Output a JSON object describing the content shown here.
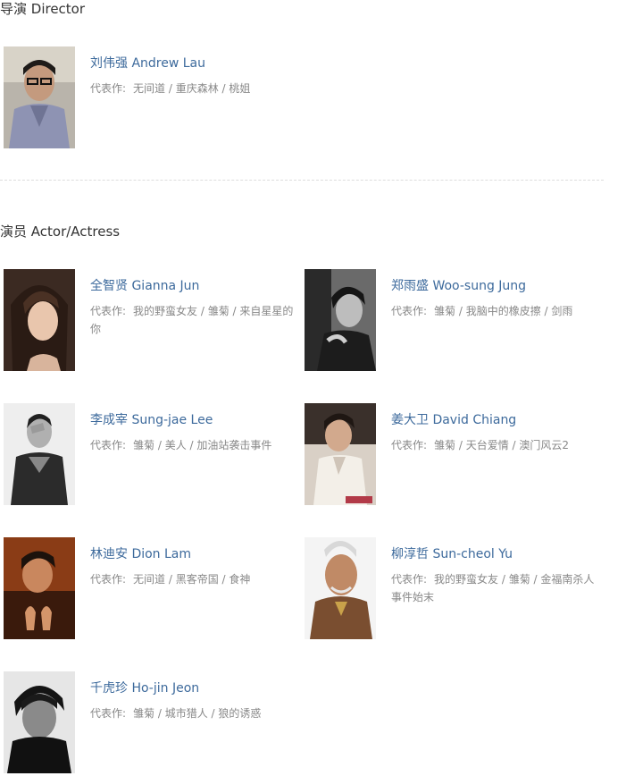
{
  "director_section": {
    "title": "导演 Director",
    "people": [
      {
        "name": "刘伟强 Andrew Lau",
        "works_label": "代表作:",
        "works": "无间道 / 重庆森林 / 桃姐"
      }
    ]
  },
  "actor_section": {
    "title": "演员 Actor/Actress",
    "people": [
      {
        "name": "全智贤 Gianna Jun",
        "works_label": "代表作:",
        "works": "我的野蛮女友 / 雏菊 / 来自星星的你"
      },
      {
        "name": "郑雨盛 Woo-sung Jung",
        "works_label": "代表作:",
        "works": "雏菊 / 我脑中的橡皮擦 / 剑雨"
      },
      {
        "name": "李成宰 Sung-jae Lee",
        "works_label": "代表作:",
        "works": "雏菊 / 美人 / 加油站袭击事件"
      },
      {
        "name": "姜大卫 David Chiang",
        "works_label": "代表作:",
        "works": "雏菊 / 天台爱情 / 澳门风云2"
      },
      {
        "name": "林迪安 Dion Lam",
        "works_label": "代表作:",
        "works": "无间道 / 黑客帝国 / 食神"
      },
      {
        "name": "柳淳哲 Sun-cheol Yu",
        "works_label": "代表作:",
        "works": "我的野蛮女友 / 雏菊 / 金福南杀人事件始末"
      },
      {
        "name": "千虎珍 Ho-jin Jeon",
        "works_label": "代表作:",
        "works": "雏菊 / 城市猎人 / 狼的诱惑"
      }
    ]
  }
}
